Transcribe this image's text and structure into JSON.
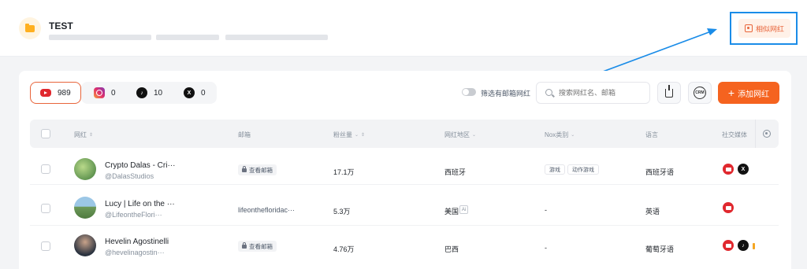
{
  "header": {
    "folder_title": "TEST",
    "similar_button": "相似网红"
  },
  "toolbar": {
    "platform_tabs": [
      {
        "platform": "youtube",
        "icon": "youtube-icon",
        "count": "989",
        "active": true
      },
      {
        "platform": "instagram",
        "icon": "instagram-icon",
        "count": "0",
        "active": false
      },
      {
        "platform": "tiktok",
        "icon": "tiktok-icon",
        "count": "10",
        "active": false
      },
      {
        "platform": "x",
        "icon": "x-icon",
        "count": "0",
        "active": false
      }
    ],
    "email_filter_label": "筛选有邮箱网红",
    "email_filter_on": false,
    "search_placeholder": "搜索网红名、邮箱",
    "crm_label": "CRM",
    "add_button": "添加网红"
  },
  "table": {
    "headers": {
      "influencer": "网红",
      "email": "邮箱",
      "followers": "粉丝量",
      "region": "网红地区",
      "nox_category": "Nox类别",
      "language": "语言",
      "social": "社交媒体"
    },
    "rows": [
      {
        "name": "Crypto Dalas - Cri···",
        "handle": "@DalasStudios",
        "email_button": "查看邮箱",
        "email": "",
        "followers": "17.1万",
        "region": "西班牙",
        "categories": [
          "游戏",
          "动作游戏"
        ],
        "language": "西班牙语",
        "social": [
          "youtube",
          "x"
        ]
      },
      {
        "name": "Lucy | Life on the ···",
        "handle": "@LifeontheFlori···",
        "email_button": "",
        "email": "lifeonthefloridac···",
        "followers": "5.3万",
        "region": "美国",
        "categories": [
          "-"
        ],
        "language": "英语",
        "social": [
          "youtube"
        ]
      },
      {
        "name": "Hevelin Agostinelli",
        "handle": "@hevelinagostin···",
        "email_button": "查看邮箱",
        "email": "",
        "followers": "4.76万",
        "region": "巴西",
        "categories": [
          "-"
        ],
        "language": "葡萄牙语",
        "social": [
          "youtube",
          "tiktok"
        ]
      }
    ]
  },
  "colors": {
    "accent": "#f5631f",
    "highlight_border": "#1a8ce8",
    "youtube": "#e0282e"
  }
}
